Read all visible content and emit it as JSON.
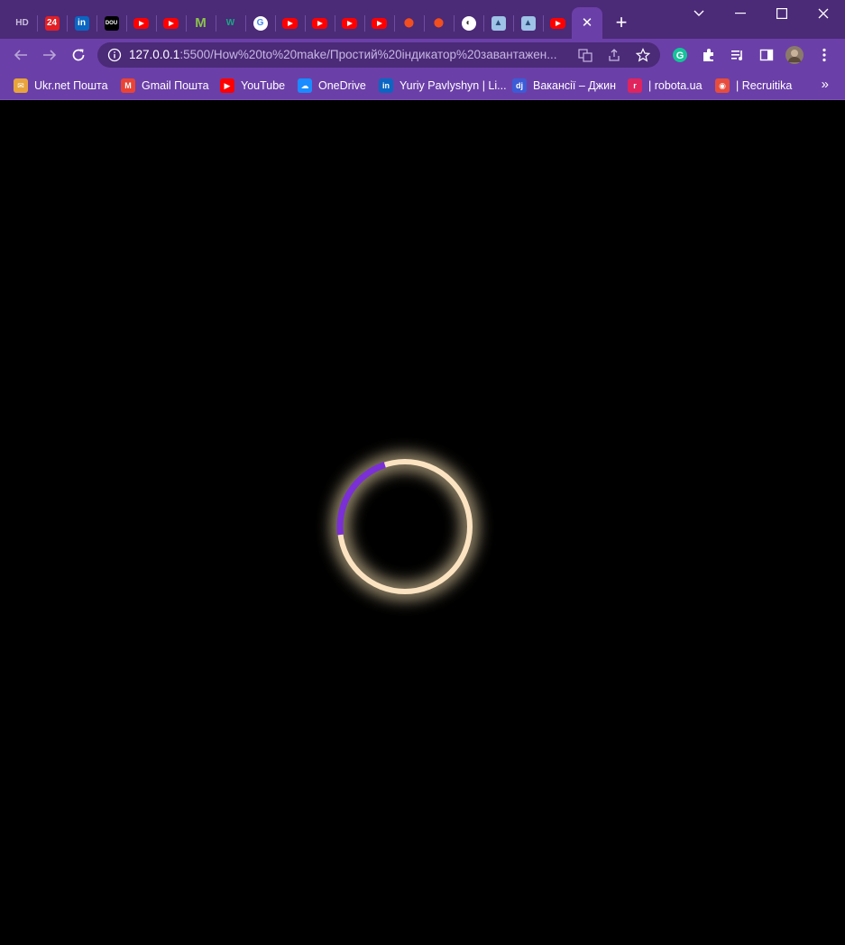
{
  "browser": {
    "tabs": [
      {
        "icon": "hd-favicon",
        "text": "HD"
      },
      {
        "icon": "24-favicon",
        "text": "24"
      },
      {
        "icon": "linkedin-favicon",
        "text": "in"
      },
      {
        "icon": "dou-favicon",
        "text": "DOU"
      },
      {
        "icon": "youtube-favicon",
        "text": ""
      },
      {
        "icon": "youtube-favicon",
        "text": ""
      },
      {
        "icon": "m-favicon",
        "text": "M"
      },
      {
        "icon": "w-favicon",
        "text": "W"
      },
      {
        "icon": "google-favicon",
        "text": "G"
      },
      {
        "icon": "youtube-favicon",
        "text": ""
      },
      {
        "icon": "youtube-favicon",
        "text": ""
      },
      {
        "icon": "youtube-favicon",
        "text": ""
      },
      {
        "icon": "youtube-favicon",
        "text": ""
      },
      {
        "icon": "figma-favicon",
        "text": ""
      },
      {
        "icon": "figma-favicon",
        "text": ""
      },
      {
        "icon": "globe-favicon",
        "text": ""
      },
      {
        "icon": "app-favicon",
        "text": ""
      },
      {
        "icon": "app-favicon",
        "text": ""
      },
      {
        "icon": "youtube-favicon",
        "text": ""
      }
    ],
    "active_tab_close": "✕",
    "new_tab": "+",
    "url_host": "127.0.0.1",
    "url_path": ":5500/How%20to%20make/Простий%20індикатор%20завантажен...",
    "bookmarks": [
      {
        "label": "Ukr.net Пошта",
        "icon": "ukrnet-icon",
        "color": "#e8a33c",
        "glyph": "✉"
      },
      {
        "label": "Gmail Пошта",
        "icon": "gmail-icon",
        "color": "#ea4335",
        "glyph": "M"
      },
      {
        "label": "YouTube",
        "icon": "youtube-icon",
        "color": "#ff0000",
        "glyph": "▶"
      },
      {
        "label": "OneDrive",
        "icon": "onedrive-icon",
        "color": "#1a8cff",
        "glyph": "☁"
      },
      {
        "label": "Yuriy Pavlyshyn | Li...",
        "icon": "linkedin-icon",
        "color": "#0a66c2",
        "glyph": "in"
      },
      {
        "label": "Вакансії – Джин",
        "icon": "djinni-icon",
        "color": "#3c5bd6",
        "glyph": "dj"
      },
      {
        "label": "| robota.ua",
        "icon": "robota-icon",
        "color": "#e0245e",
        "glyph": "r"
      },
      {
        "label": "| Recruitika",
        "icon": "recruitika-icon",
        "color": "#e74c3c",
        "glyph": "◉"
      }
    ],
    "bookmarks_more": "»"
  },
  "loader": {
    "progress": 0.22,
    "ring_color": "#fbe3c1",
    "progress_color": "#7b2fd6",
    "glow_color": "#ffe8b8",
    "background": "#000000"
  }
}
